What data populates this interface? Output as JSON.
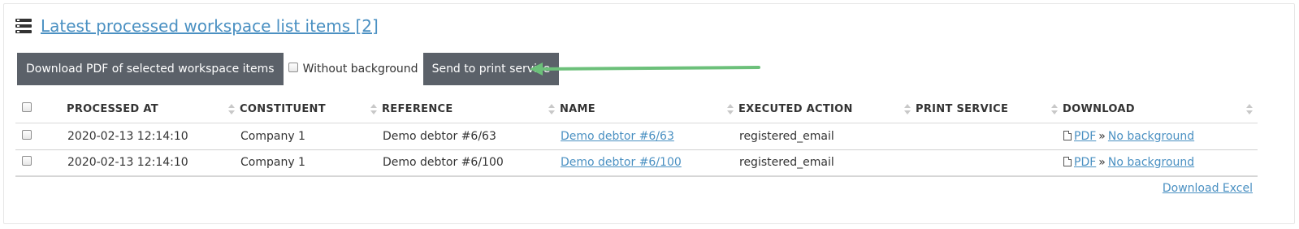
{
  "header": {
    "title": "Latest processed workspace list items [2]",
    "icon": "list-icon"
  },
  "toolbar": {
    "download_pdf_label": "Download PDF of selected workspace items",
    "without_background_label": "Without background",
    "send_print_label": "Send to print service"
  },
  "annotation": {
    "arrow_color": "#6cc07a"
  },
  "table": {
    "columns": [
      "PROCESSED AT",
      "CONSTITUENT",
      "REFERENCE",
      "NAME",
      "EXECUTED ACTION",
      "PRINT SERVICE",
      "DOWNLOAD"
    ],
    "rows": [
      {
        "processed_at": "2020-02-13 12:14:10",
        "constituent": "Company 1",
        "reference": "Demo debtor #6/63",
        "name": "Demo debtor #6/63",
        "executed_action": "registered_email",
        "print_service": "",
        "pdf_label": "PDF",
        "separator": "»",
        "no_background_label": "No background"
      },
      {
        "processed_at": "2020-02-13 12:14:10",
        "constituent": "Company 1",
        "reference": "Demo debtor #6/100",
        "name": "Demo debtor #6/100",
        "executed_action": "registered_email",
        "print_service": "",
        "pdf_label": "PDF",
        "separator": "»",
        "no_background_label": "No background"
      }
    ]
  },
  "footer": {
    "download_excel_label": "Download Excel"
  }
}
